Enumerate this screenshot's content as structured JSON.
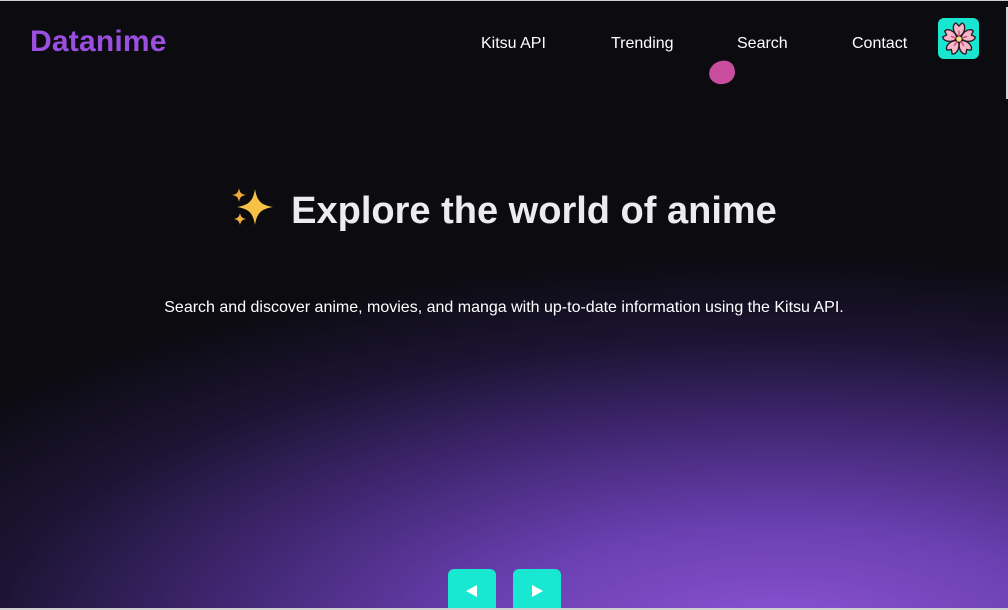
{
  "brand": {
    "name": "Datanime",
    "color": "#9a4fe0"
  },
  "nav": {
    "items": [
      {
        "label": "Kitsu API"
      },
      {
        "label": "Trending"
      },
      {
        "label": "Search"
      },
      {
        "label": "Contact"
      }
    ]
  },
  "avatar": {
    "icon": "cherry-blossom-icon",
    "background": "#19e6d0"
  },
  "hero": {
    "icon": "sparkles-icon",
    "title": "Explore the world of anime",
    "subtitle": "Search and discover anime, movies, and manga with up-to-date information using the Kitsu API."
  },
  "carousel": {
    "prev_icon": "triangle-left-icon",
    "next_icon": "triangle-right-icon",
    "button_color": "#18e8d2"
  },
  "colors": {
    "background": "#0b0b10",
    "gradient_accent": "#8e55d6",
    "cursor_blob": "#c94d9e"
  }
}
